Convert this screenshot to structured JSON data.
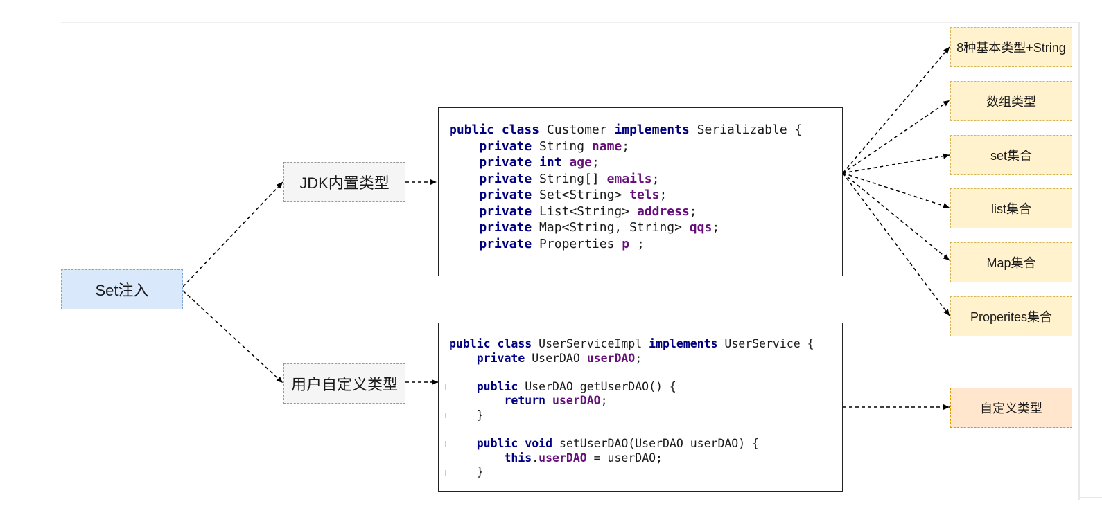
{
  "root": {
    "label": "Set注入"
  },
  "branches": {
    "jdk": {
      "label": "JDK内置类型"
    },
    "user": {
      "label": "用户自定义类型"
    }
  },
  "code_customer": {
    "lines": [
      [
        {
          "t": "public class",
          "s": "kw"
        },
        {
          "t": " Customer "
        },
        {
          "t": "implements",
          "s": "kw"
        },
        {
          "t": " Serializable {"
        }
      ],
      [
        {
          "t": "    "
        },
        {
          "t": "private",
          "s": "kw"
        },
        {
          "t": " String "
        },
        {
          "t": "name",
          "s": "fld"
        },
        {
          "t": ";"
        }
      ],
      [
        {
          "t": "    "
        },
        {
          "t": "private int",
          "s": "kw"
        },
        {
          "t": " "
        },
        {
          "t": "age",
          "s": "fld"
        },
        {
          "t": ";"
        }
      ],
      [
        {
          "t": "    "
        },
        {
          "t": "private",
          "s": "kw"
        },
        {
          "t": " String[] "
        },
        {
          "t": "emails",
          "s": "fld"
        },
        {
          "t": ";"
        }
      ],
      [
        {
          "t": "    "
        },
        {
          "t": "private",
          "s": "kw"
        },
        {
          "t": " Set<String> "
        },
        {
          "t": "tels",
          "s": "fld"
        },
        {
          "t": ";"
        }
      ],
      [
        {
          "t": "    "
        },
        {
          "t": "private",
          "s": "kw"
        },
        {
          "t": " List<String> "
        },
        {
          "t": "address",
          "s": "fld"
        },
        {
          "t": ";"
        }
      ],
      [
        {
          "t": "    "
        },
        {
          "t": "private",
          "s": "kw"
        },
        {
          "t": " Map<String, String> "
        },
        {
          "t": "qqs",
          "s": "fld"
        },
        {
          "t": ";"
        }
      ],
      [
        {
          "t": "    "
        },
        {
          "t": "private",
          "s": "kw"
        },
        {
          "t": " Properties "
        },
        {
          "t": "p",
          "s": "fld"
        },
        {
          "t": " ;"
        }
      ]
    ]
  },
  "code_userservice": {
    "lines": [
      [
        {
          "t": "public class",
          "s": "kw"
        },
        {
          "t": " UserServiceImpl "
        },
        {
          "t": "implements",
          "s": "kw"
        },
        {
          "t": " UserService {"
        }
      ],
      [
        {
          "t": "    "
        },
        {
          "t": "private",
          "s": "kw"
        },
        {
          "t": " UserDAO "
        },
        {
          "t": "userDAO",
          "s": "fld"
        },
        {
          "t": ";"
        }
      ],
      [],
      [
        {
          "t": "    "
        },
        {
          "t": "public",
          "s": "kw"
        },
        {
          "t": " UserDAO getUserDAO() {"
        }
      ],
      [
        {
          "t": "        "
        },
        {
          "t": "return",
          "s": "kw"
        },
        {
          "t": " "
        },
        {
          "t": "userDAO",
          "s": "fld"
        },
        {
          "t": ";"
        }
      ],
      [
        {
          "t": "    }"
        }
      ],
      [],
      [
        {
          "t": "    "
        },
        {
          "t": "public void",
          "s": "kw"
        },
        {
          "t": " setUserDAO(UserDAO userDAO) {"
        }
      ],
      [
        {
          "t": "        "
        },
        {
          "t": "this",
          "s": "kw"
        },
        {
          "t": "."
        },
        {
          "t": "userDAO",
          "s": "fld"
        },
        {
          "t": " = userDAO;"
        }
      ],
      [
        {
          "t": "    }"
        }
      ]
    ]
  },
  "targets": [
    {
      "label": "8种基本类型+String"
    },
    {
      "label": "数组类型"
    },
    {
      "label": "set集合"
    },
    {
      "label": "list集合"
    },
    {
      "label": "Map集合"
    },
    {
      "label": "Properites集合"
    }
  ],
  "custom_target": {
    "label": "自定义类型"
  },
  "colors": {
    "root_fill": "#dae8fc",
    "branch_fill": "#f5f5f5",
    "target_fill": "#fff2cc",
    "custom_fill": "#ffe6cc",
    "keyword": "#000080",
    "field": "#660e7a"
  }
}
